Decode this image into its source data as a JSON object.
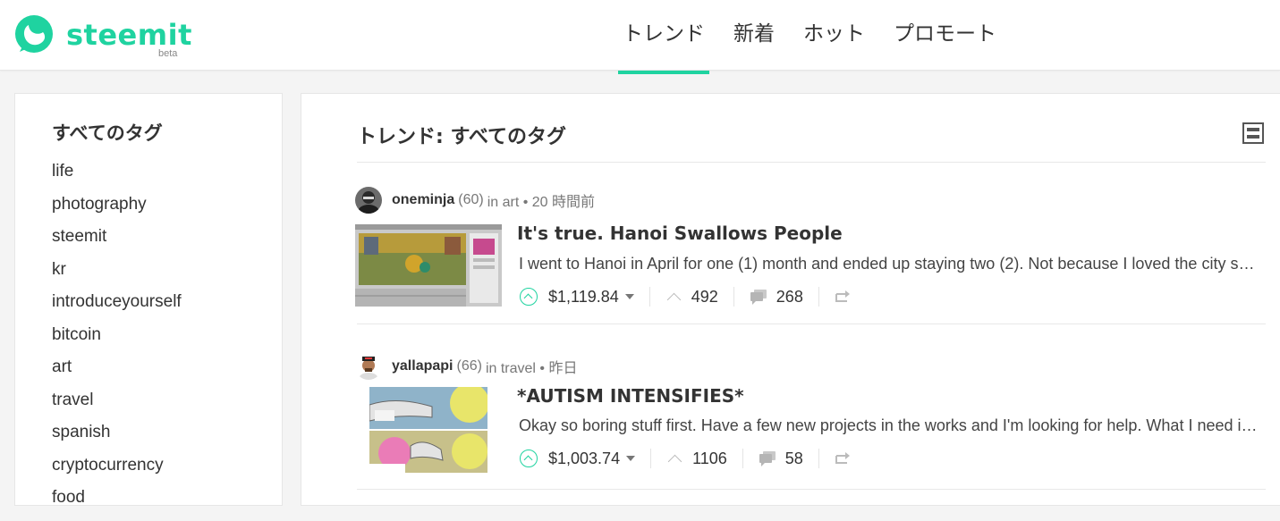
{
  "brand": {
    "name": "steemit",
    "badge": "beta",
    "color": "#1fd3a0"
  },
  "nav": [
    {
      "label": "トレンド",
      "active": true
    },
    {
      "label": "新着",
      "active": false
    },
    {
      "label": "ホット",
      "active": false
    },
    {
      "label": "プロモート",
      "active": false
    }
  ],
  "sidebar": {
    "title": "すべてのタグ",
    "tags": [
      "life",
      "photography",
      "steemit",
      "kr",
      "introduceyourself",
      "bitcoin",
      "art",
      "travel",
      "spanish",
      "cryptocurrency",
      "food"
    ]
  },
  "main": {
    "title": "トレンド: すべてのタグ",
    "layout_icon": "list-layout-icon"
  },
  "posts": [
    {
      "author": "oneminja",
      "reputation": "(60)",
      "meta": "in art • 20 時間前",
      "title": "It's true. Hanoi Swallows People",
      "excerpt": "I went to Hanoi in April for one (1) month and ended up staying two (2). Not because I loved the city so much but because the city swallowed me whole and would not let me go.",
      "payout": "$1,119.84",
      "votes": "492",
      "comments": "268"
    },
    {
      "author": "yallapapi",
      "reputation": "(66)",
      "meta": "in travel • 昨日",
      "title": "*AUTISM INTENSIFIES*",
      "excerpt": "Okay so boring stuff first. Have a few new projects in the works and I'm looking for help. What I need is somebody who can help me with a few things.",
      "payout": "$1,003.74",
      "votes": "1106",
      "comments": "58"
    }
  ]
}
